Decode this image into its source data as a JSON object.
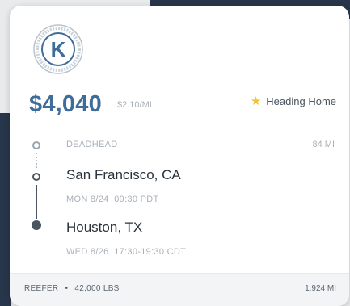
{
  "price": {
    "total": "$4,040",
    "rate": "$2.10/MI"
  },
  "badge": {
    "icon": "star-icon",
    "label": "Heading Home",
    "color": "#f2c230"
  },
  "route": {
    "deadhead_label": "DEADHEAD",
    "deadhead_miles": "84 MI",
    "origin": {
      "city": "San Francisco, CA",
      "time": "MON 8/24  09:30 PDT"
    },
    "destination": {
      "city": "Houston, TX",
      "time": "WED 8/26  17:30-19:30 CDT"
    }
  },
  "footer": {
    "equipment": "REEFER",
    "separator": "•",
    "weight": "42,000 LBS",
    "distance": "1,924 MI"
  },
  "colors": {
    "brand": "#3f6d99",
    "muted": "#a9b0b8",
    "text": "#2a333c"
  }
}
